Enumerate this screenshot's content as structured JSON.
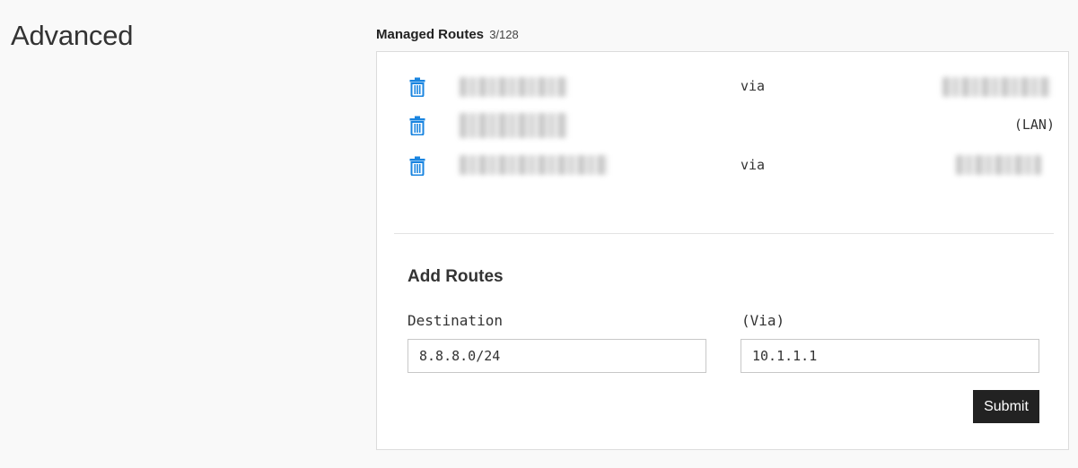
{
  "page": {
    "title": "Advanced"
  },
  "managed_routes": {
    "label": "Managed Routes",
    "count": "3/128",
    "routes": [
      {
        "via_label": "via",
        "suffix": ""
      },
      {
        "via_label": "",
        "suffix": "(LAN)"
      },
      {
        "via_label": "via",
        "suffix": ""
      }
    ]
  },
  "add_routes": {
    "title": "Add Routes",
    "destination_label": "Destination",
    "destination_value": "8.8.8.0/24",
    "via_label": "(Via)",
    "via_value": "10.1.1.1",
    "submit_label": "Submit"
  },
  "colors": {
    "icon_blue": "#1a85e0",
    "button_dark": "#222222"
  }
}
